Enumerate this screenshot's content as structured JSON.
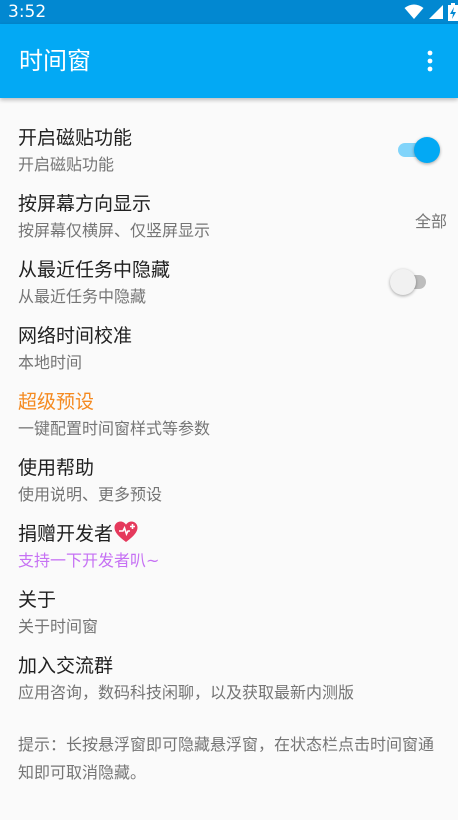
{
  "status_bar": {
    "time": "3:52"
  },
  "app_bar": {
    "title": "时间窗",
    "menu_icon": "more-vert-icon"
  },
  "colors": {
    "primary": "#03a9f4",
    "primary_dark": "#0288d1",
    "accent_orange": "#f58a20",
    "accent_purple": "#c671f4",
    "heart": "#e5395c"
  },
  "preferences": [
    {
      "title": "开启磁贴功能",
      "summary": "开启磁贴功能",
      "switch_on": true
    },
    {
      "title": "按屏幕方向显示",
      "summary": "按屏幕仅横屏、仅竖屏显示",
      "value": "全部"
    },
    {
      "title": "从最近任务中隐藏",
      "summary": "从最近任务中隐藏",
      "switch_on": false
    },
    {
      "title": "网络时间校准",
      "summary": "本地时间"
    },
    {
      "title": "超级预设",
      "summary": "一键配置时间窗样式等参数"
    },
    {
      "title": "使用帮助",
      "summary": "使用说明、更多预设"
    },
    {
      "title": "捐赠开发者",
      "summary": "支持一下开发者叭~",
      "icon": "heart-plus-icon"
    },
    {
      "title": "关于",
      "summary": "关于时间窗"
    },
    {
      "title": "加入交流群",
      "summary": "应用咨询，数码科技闲聊，以及获取最新内测版"
    }
  ],
  "footer_tip": "提示：长按悬浮窗即可隐藏悬浮窗，在状态栏点击时间窗通知即可取消隐藏。"
}
